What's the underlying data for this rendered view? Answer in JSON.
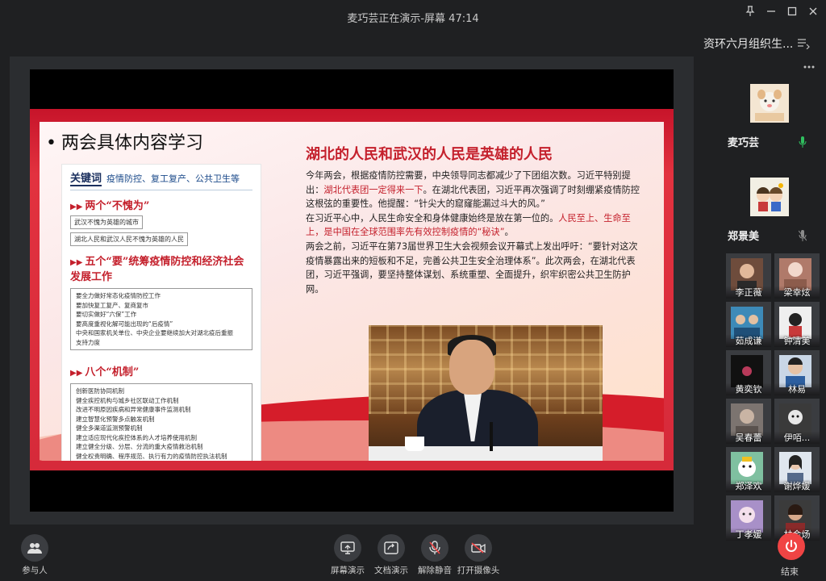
{
  "window": {
    "title": "麦巧芸正在演示-屏幕 47:14"
  },
  "slide": {
    "heading": "两会具体内容学习",
    "keyword_label": "关键词",
    "keywords": "疫情防控、复工复产、公共卫生等",
    "section1_title": "两个“不愧为”",
    "section1_items": [
      "武汉不愧为英雄的城市",
      "湖北人民和武汉人民不愧为英雄的人民"
    ],
    "section2_title": "五个“要”统筹疫情防控和经济社会发展工作",
    "section2_items": [
      "要全力做好常态化疫情防控工作",
      "要加快复工复产、复商复市",
      "要切实做好“六保”工作",
      "要高度重视化解可能出现的“后疫情”",
      "中央和国家机关单位、中央企业要继续加大对湖北疫后重振",
      "支持力度"
    ],
    "section3_title": "八个“机制”",
    "section3_items": [
      "创新医防协同机制",
      "健全疾控机构与城乡社区联动工作机制",
      "改进不明原因疾病和异常健康事件监测机制",
      "建立智慧化预警多点触发机制",
      "健全多渠道监测预警机制",
      "建立适应现代化疾控体系的人才培养使用机制",
      "建立健全分级、分层、分流的重大疫情救治机制",
      "健全权责明确、程序规范、执行有力的疫情防控执法机制"
    ],
    "main_title": "湖北的人民和武汉的人民是英雄的人民",
    "para1_a": "今年两会，根据疫情防控需要，中央领导同志都减少了下团组次数。习近平特别提出：",
    "para1_hl": "湖北代表团一定得来一下",
    "para1_b": "。在湖北代表团，习近平再次强调了时刻绷紧疫情防控这根弦的重要性。他提醒：“针尖大的窟窿能漏过斗大的风。”",
    "para2_a": "在习近平心中，人民生命安全和身体健康始终是放在第一位的。",
    "para2_hl": "人民至上、生命至上，是中国在全球范围率先有效控制疫情的“秘诀”",
    "para2_b": "。",
    "para3": "两会之前，习近平在第73届世界卫生大会视频会议开幕式上发出呼吁：“要针对这次疫情暴露出来的短板和不足，完善公共卫生安全治理体系”。此次两会，在湖北代表团，习近平强调，要坚持整体谋划、系统重塑、全面提升，织牢织密公共卫生防护网。"
  },
  "panel": {
    "group_name": "资环六月组织生...",
    "speakers": [
      {
        "name": "麦巧芸",
        "mic": "on"
      },
      {
        "name": "郑景美",
        "mic": "off"
      }
    ],
    "participants": [
      {
        "name": "李正薇"
      },
      {
        "name": "梁幸炫"
      },
      {
        "name": "茹成谦"
      },
      {
        "name": "钟清美"
      },
      {
        "name": "黄奕钦"
      },
      {
        "name": "林易"
      },
      {
        "name": "吴春蕾"
      },
      {
        "name": "伊咟..."
      },
      {
        "name": "郑泽欢"
      },
      {
        "name": "谢烨媛"
      },
      {
        "name": "丁孝媛"
      },
      {
        "name": "林金炀"
      }
    ],
    "end_label": "结束"
  },
  "toolbar": {
    "participants_label": "参与人",
    "screen_share_label": "屏幕演示",
    "doc_share_label": "文档演示",
    "unmute_label": "解除静音",
    "camera_label": "打开摄像头"
  },
  "colors": {
    "accent_red": "#c4202c",
    "end_button": "#f04444",
    "mic_on": "#2fbf5f"
  }
}
